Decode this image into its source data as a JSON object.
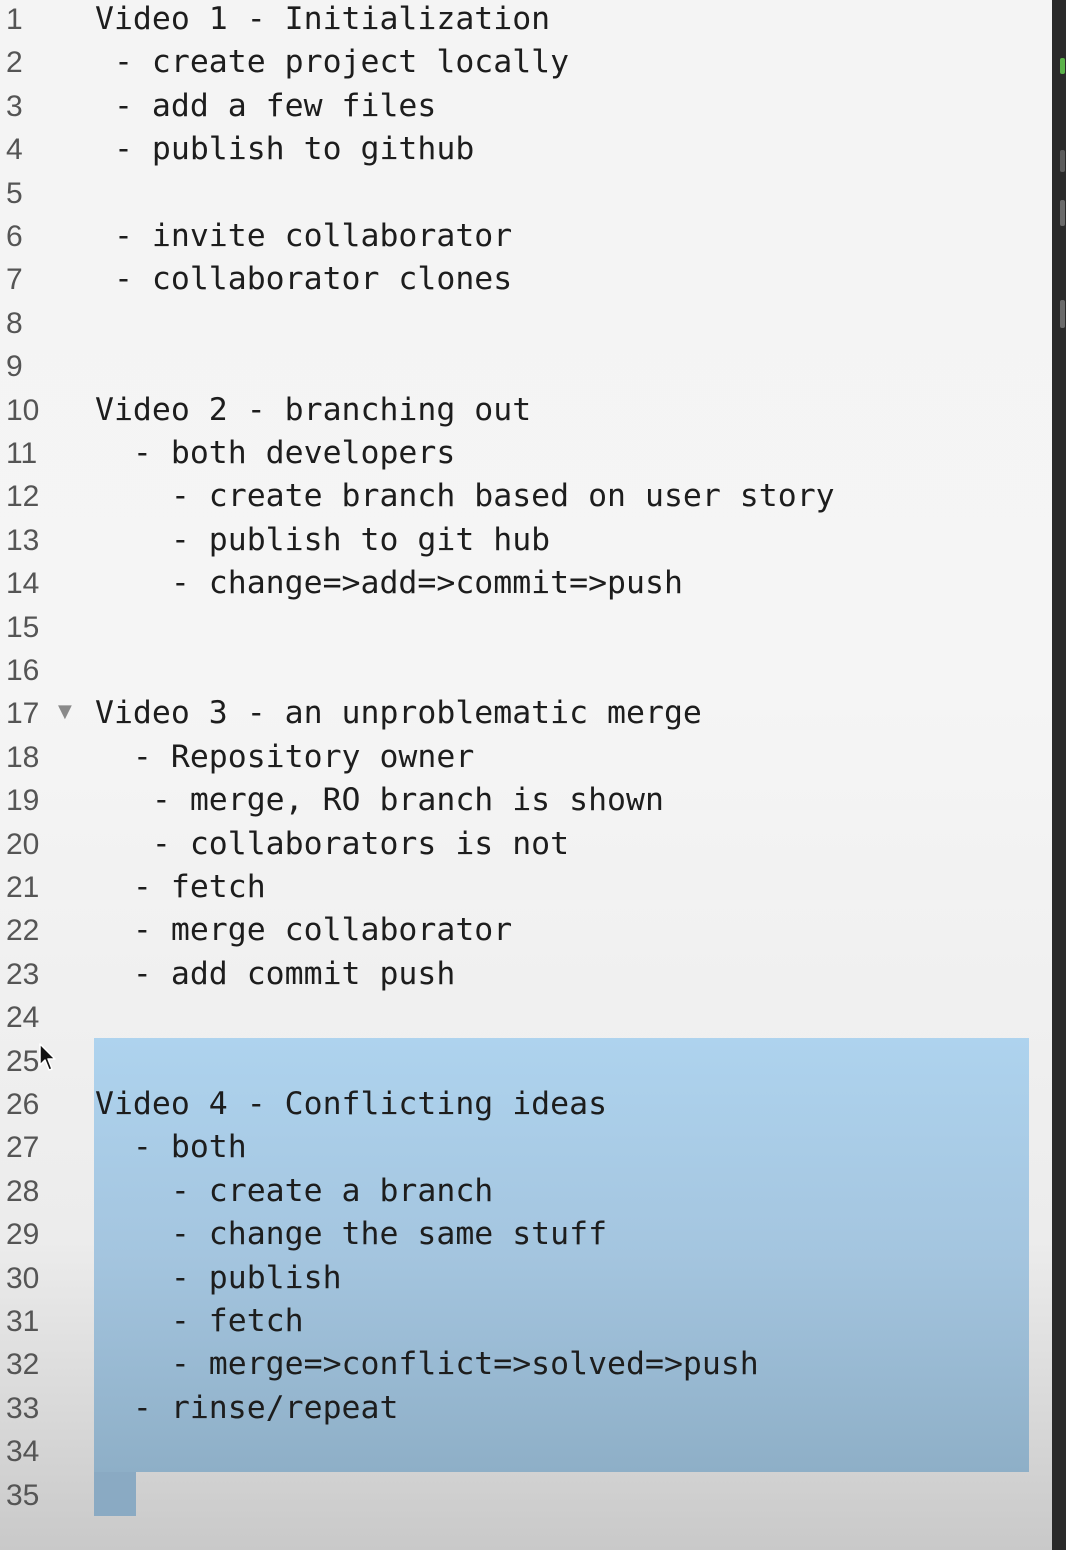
{
  "editor": {
    "lines": [
      {
        "num": "1",
        "text": "Video 1 - Initialization"
      },
      {
        "num": "2",
        "text": " - create project locally"
      },
      {
        "num": "3",
        "text": " - add a few files"
      },
      {
        "num": "4",
        "text": " - publish to github"
      },
      {
        "num": "5",
        "text": ""
      },
      {
        "num": "6",
        "text": " - invite collaborator"
      },
      {
        "num": "7",
        "text": " - collaborator clones"
      },
      {
        "num": "8",
        "text": ""
      },
      {
        "num": "9",
        "text": ""
      },
      {
        "num": "10",
        "text": "Video 2 - branching out"
      },
      {
        "num": "11",
        "text": "  - both developers"
      },
      {
        "num": "12",
        "text": "    - create branch based on user story"
      },
      {
        "num": "13",
        "text": "    - publish to git hub"
      },
      {
        "num": "14",
        "text": "    - change=>add=>commit=>push"
      },
      {
        "num": "15",
        "text": ""
      },
      {
        "num": "16",
        "text": ""
      },
      {
        "num": "17",
        "text": "Video 3 - an unproblematic merge",
        "fold": true
      },
      {
        "num": "18",
        "text": "  - Repository owner"
      },
      {
        "num": "19",
        "text": "   - merge, RO branch is shown"
      },
      {
        "num": "20",
        "text": "   - collaborators is not"
      },
      {
        "num": "21",
        "text": "  - fetch"
      },
      {
        "num": "22",
        "text": "  - merge collaborator"
      },
      {
        "num": "23",
        "text": "  - add commit push"
      },
      {
        "num": "24",
        "text": ""
      },
      {
        "num": "25",
        "text": ""
      },
      {
        "num": "26",
        "text": "Video 4 - Conflicting ideas"
      },
      {
        "num": "27",
        "text": "  - both"
      },
      {
        "num": "28",
        "text": "    - create a branch"
      },
      {
        "num": "29",
        "text": "    - change the same stuff"
      },
      {
        "num": "30",
        "text": "    - publish"
      },
      {
        "num": "31",
        "text": "    - fetch"
      },
      {
        "num": "32",
        "text": "    - merge=>conflict=>solved=>push"
      },
      {
        "num": "33",
        "text": "  - rinse/repeat"
      },
      {
        "num": "34",
        "text": ""
      },
      {
        "num": "35",
        "text": ""
      }
    ],
    "fold_icon": "fold-triangle-icon",
    "selection_color": "#a8cbe6",
    "text_color": "#1d1d1d",
    "gutter_color": "#555555"
  },
  "scrollbar": {
    "markers": [
      {
        "color": "#5bb24a",
        "icon": "change-marker"
      },
      {
        "color": "#888888",
        "icon": "change-marker"
      },
      {
        "color": "#888888",
        "icon": "change-marker"
      }
    ]
  }
}
